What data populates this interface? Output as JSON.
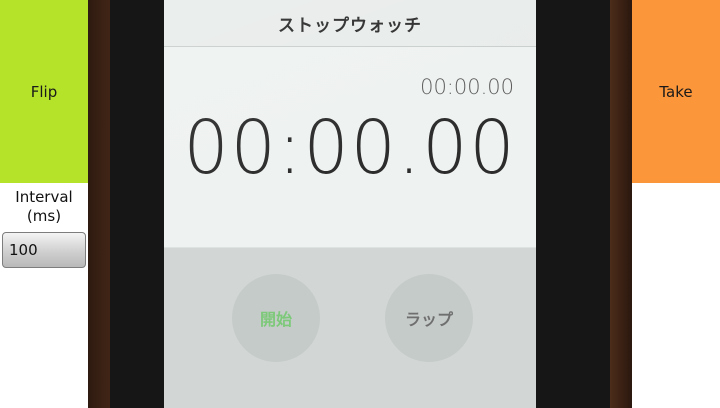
{
  "controls": {
    "flip_label": "Flip",
    "take_label": "Take",
    "interval_label_line1": "Interval",
    "interval_label_line2": "(ms)",
    "interval_value": "100"
  },
  "colors": {
    "flip_button": "#b5e32a",
    "take_button": "#fb963a"
  },
  "preview": {
    "stopwatch_title": "ストップウォッチ",
    "lap_time": "00:00.00",
    "main_time": "00:00.00",
    "start_label": "開始",
    "lap_label": "ラップ"
  }
}
